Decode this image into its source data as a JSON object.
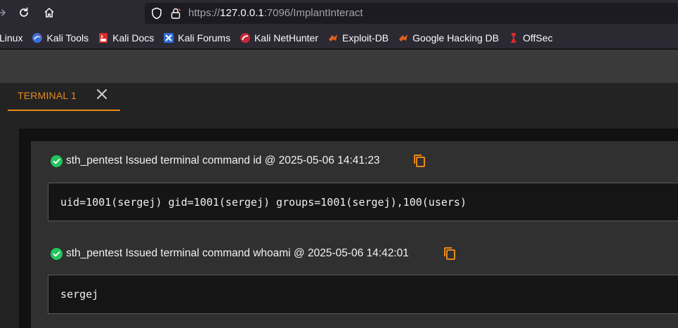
{
  "browser": {
    "url_scheme": "https://",
    "url_host": "127.0.0.1",
    "url_path": ":7096/ImplantInteract",
    "icons": [
      "forward-icon",
      "reload-icon",
      "home-icon",
      "shield-icon",
      "lock-icon"
    ]
  },
  "bookmarks": [
    {
      "label": "Linux",
      "icon": "none"
    },
    {
      "label": "Kali Tools",
      "icon": "kali-tools-icon"
    },
    {
      "label": "Kali Docs",
      "icon": "kali-docs-icon"
    },
    {
      "label": "Kali Forums",
      "icon": "kali-forums-icon"
    },
    {
      "label": "Kali NetHunter",
      "icon": "kali-nethunter-icon"
    },
    {
      "label": "Exploit-DB",
      "icon": "exploit-db-icon"
    },
    {
      "label": "Google Hacking DB",
      "icon": "ghdb-icon"
    },
    {
      "label": "OffSec",
      "icon": "offsec-icon"
    }
  ],
  "terminal": {
    "tab_label": "TERMINAL 1",
    "entries": [
      {
        "header": "sth_pentest Issued terminal command id @ 2025-05-06 14:41:23",
        "output": "uid=1001(sergej) gid=1001(sergej) groups=1001(sergej),100(users)"
      },
      {
        "header": "sth_pentest Issued terminal command whoami @ 2025-05-06 14:42:01",
        "output": "sergej"
      }
    ]
  },
  "colors": {
    "accent": "#e8891c",
    "success": "#22c55e",
    "terminal_bg": "#151515"
  }
}
